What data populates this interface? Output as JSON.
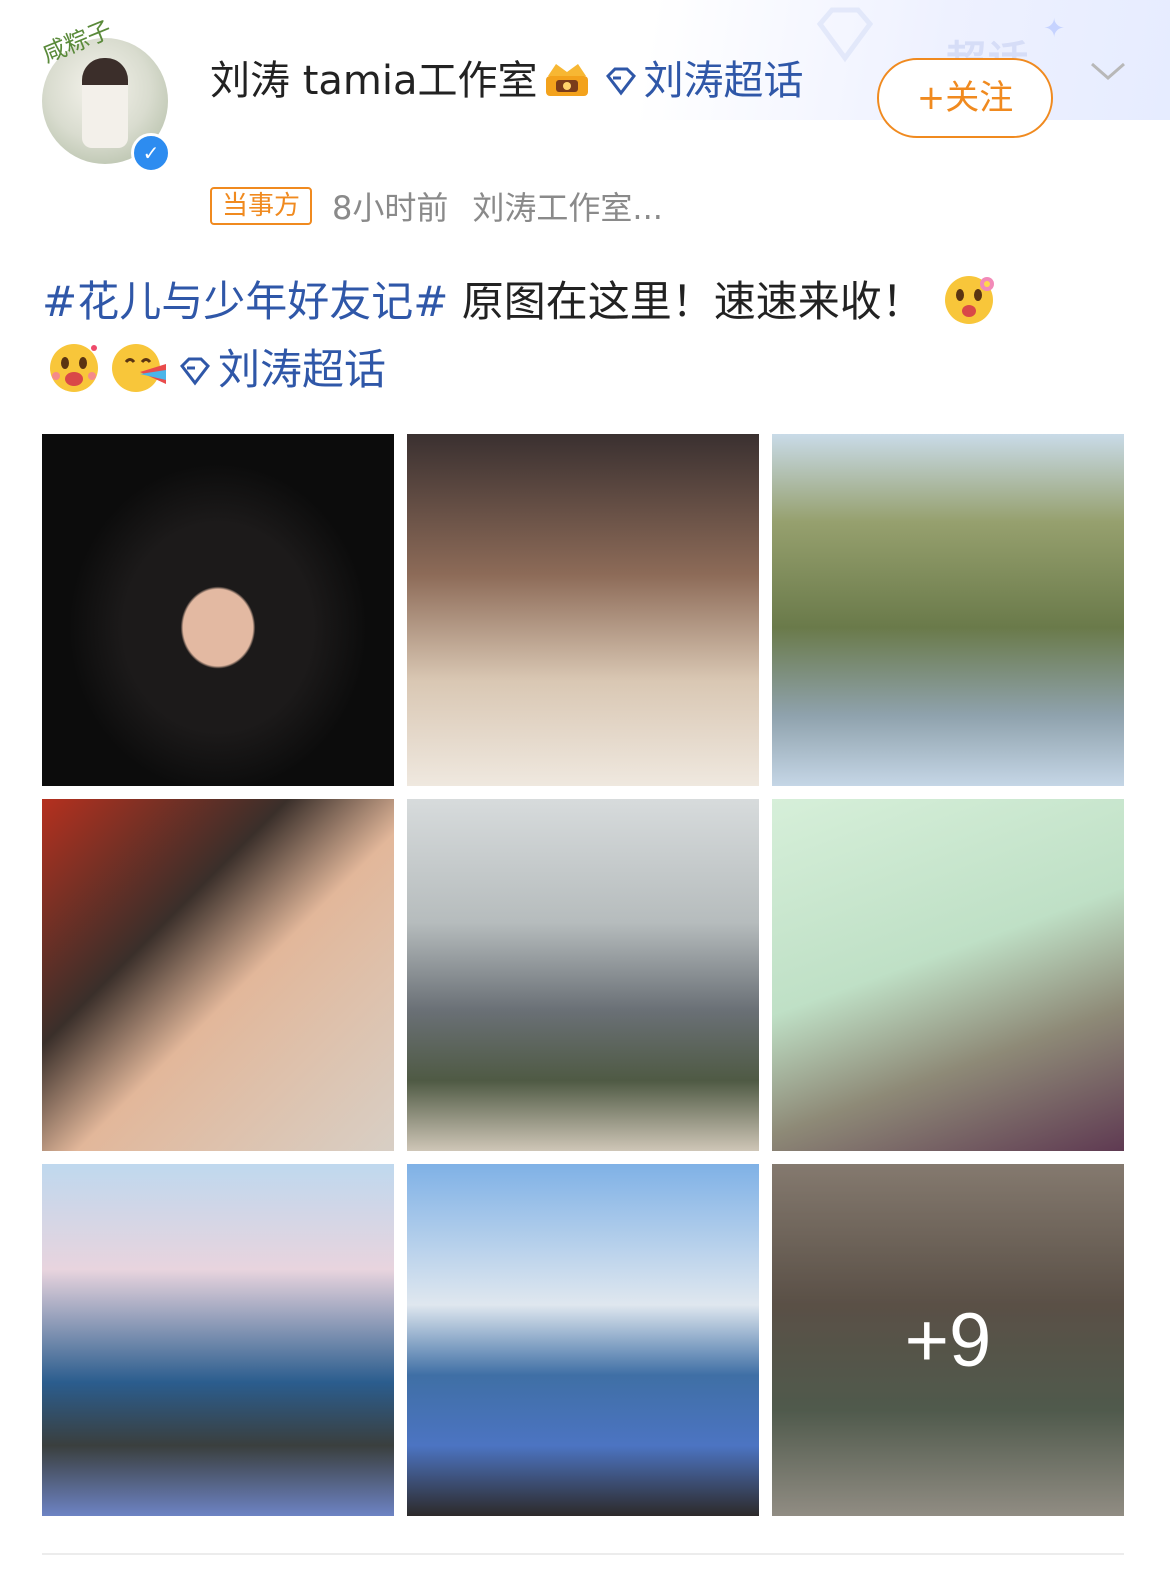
{
  "header": {
    "watermark": "超话",
    "follow_label": "+关注"
  },
  "user": {
    "avatar_tag": "咸粽子",
    "name": "刘涛 tamia工作室",
    "topic_link": "刘涛超话",
    "badge": "当事方",
    "time": "8小时前",
    "source": "刘涛工作室..."
  },
  "post": {
    "hashtag": "#花儿与少年好友记#",
    "text": " 原图在这里！速速来收！",
    "topic_link": "刘涛超话"
  },
  "gallery": {
    "photos": [
      {
        "scene": "night-portrait"
      },
      {
        "scene": "sunglasses-cafe"
      },
      {
        "scene": "mountain-cap"
      },
      {
        "scene": "market-polaroid"
      },
      {
        "scene": "cloudy-sky-profile"
      },
      {
        "scene": "green-room"
      },
      {
        "scene": "sea-pink-clouds"
      },
      {
        "scene": "sea-sunset"
      },
      {
        "scene": "courtyard-seated"
      }
    ],
    "more_count": "+9"
  },
  "colors": {
    "accent_orange": "#f08a1f",
    "link_blue": "#2f57a8",
    "verified_blue": "#2d8cf0"
  }
}
